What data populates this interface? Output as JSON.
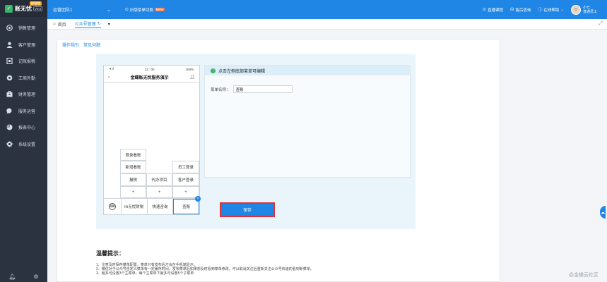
{
  "sidebar": {
    "logo": "账无忧",
    "version": "V6.5",
    "tag": "管理端",
    "items": [
      {
        "label": "销售管理",
        "icon": "target-icon"
      },
      {
        "label": "客户管理",
        "icon": "user-icon"
      },
      {
        "label": "记账报税",
        "icon": "ledger-icon"
      },
      {
        "label": "工商外勤",
        "icon": "gear-icon"
      },
      {
        "label": "财务管理",
        "icon": "briefcase-icon"
      },
      {
        "label": "服务运营",
        "icon": "chat-icon"
      },
      {
        "label": "报表中心",
        "icon": "pie-chart-icon"
      },
      {
        "label": "系统设置",
        "icon": "settings-icon"
      }
    ]
  },
  "topbar": {
    "org": "运营团队1",
    "notice": "旧版菜单切换",
    "new_badge": "NEW",
    "links": [
      "直播课程",
      "售后咨询",
      "在线帮助"
    ],
    "user_name": "小七",
    "user_role": "普通员工"
  },
  "tabs": {
    "home": "首页",
    "active": "公众号管理"
  },
  "subnav": [
    "操作指引",
    "常见问题"
  ],
  "phone": {
    "signal": "▾.ıl",
    "time": "12 : 00",
    "battery": "100%",
    "title": "金蝶账无忧服务演示",
    "menu_cells": {
      "c1": "登录看账",
      "c2": "新增看账",
      "c3": "员工登录",
      "c4": "报税",
      "c5": "代办项目",
      "c6": "客户登录",
      "plus": "+"
    },
    "bottom": [
      "Hi无忧财税",
      "快速咨询",
      "查账"
    ]
  },
  "form": {
    "hint": "点击左侧底部菜单可编辑",
    "label": "菜单名称：",
    "value": "查账"
  },
  "save_label": "保存",
  "tips": {
    "title": "温馨提示：",
    "lines": [
      "1、注意及时保存菜单配置，菜单只有发布后才会在手机端显示。",
      "2、微信对于公众号自定义菜单有一定缓存时间，发布菜单后如果想及时看到菜单修改，可以取消关注后重新关注公众号快速的看到新菜单。",
      "3、最多可设置3个主菜单，每个主菜单下最多可设置5个子菜单"
    ]
  },
  "watermark": "@金蝶云社区"
}
